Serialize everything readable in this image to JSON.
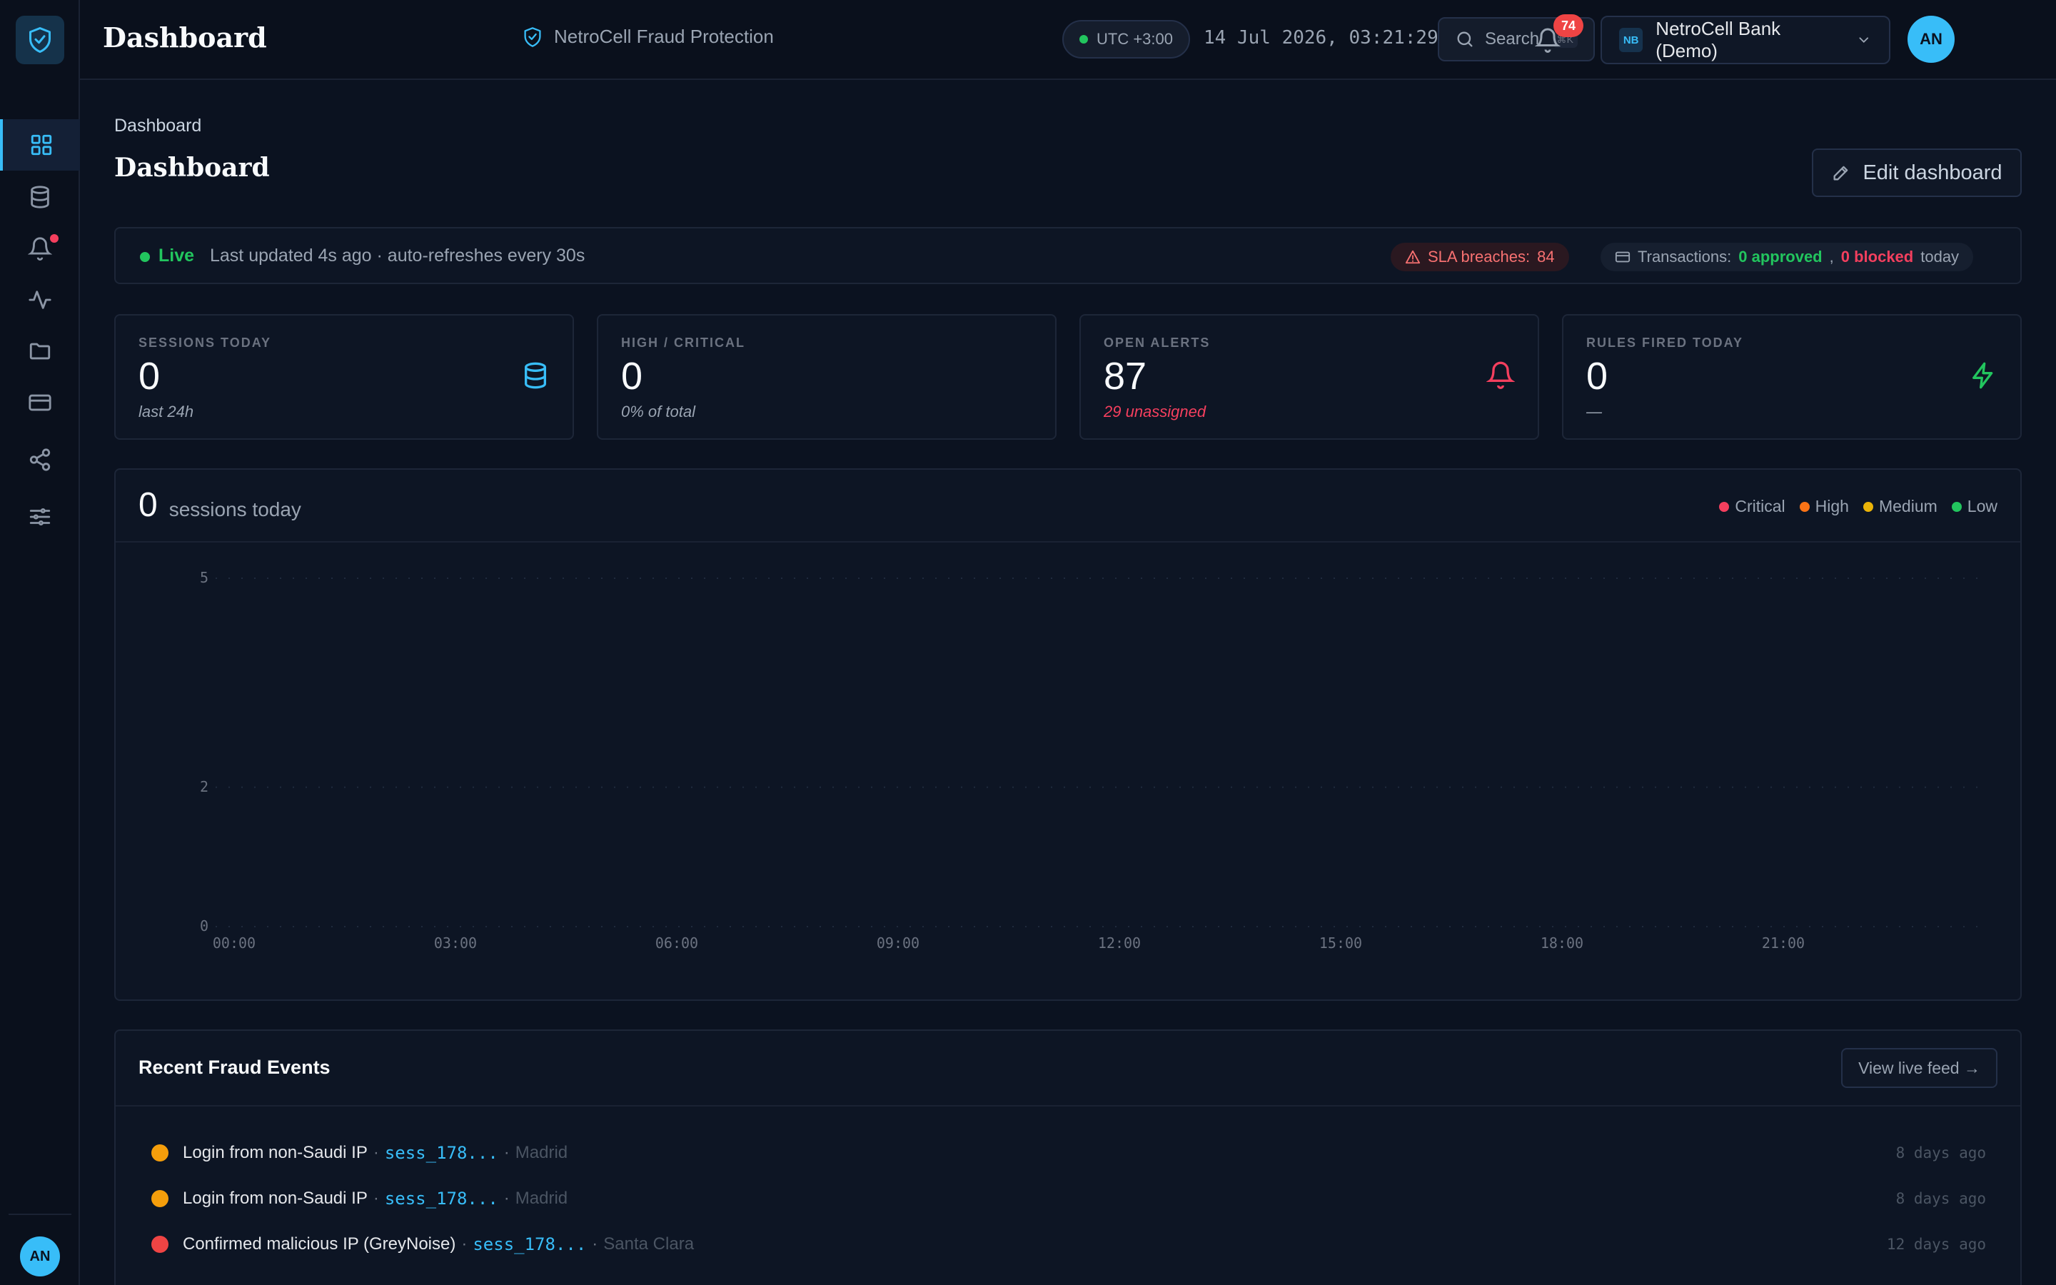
{
  "header": {
    "title": "Dashboard",
    "product": "NetroCell Fraud Protection",
    "timezone": "UTC +3:00",
    "datetime": "14 Jul 2026, 03:21:29",
    "search_label": "Search",
    "search_shortcut": "⌘K",
    "notification_count": "74",
    "org_initials": "NB",
    "org_name": "NetroCell Bank (Demo)",
    "user_initials": "AN"
  },
  "sidebar": {
    "items": [
      "dashboard",
      "sessions",
      "alerts",
      "activity",
      "cases",
      "transactions",
      "network",
      "rules"
    ],
    "user_initials": "AN"
  },
  "page": {
    "breadcrumb": "Dashboard",
    "title": "Dashboard",
    "edit_label": "Edit dashboard"
  },
  "status": {
    "live_label": "Live",
    "updated_text": "Last updated 4s ago · auto-refreshes every 30s",
    "sla_label": "SLA breaches:",
    "sla_value": "84",
    "tx_label": "Transactions:",
    "tx_approved": "0 approved",
    "tx_comma": ",",
    "tx_blocked": "0 blocked",
    "tx_suffix": "today"
  },
  "cards": [
    {
      "label": "SESSIONS TODAY",
      "value": "0",
      "sub": "last 24h"
    },
    {
      "label": "HIGH / CRITICAL",
      "value": "0",
      "sub": "0% of total"
    },
    {
      "label": "OPEN ALERTS",
      "value": "87",
      "sub": "29 unassigned"
    },
    {
      "label": "RULES FIRED TODAY",
      "value": "0",
      "sub": "—"
    }
  ],
  "chart": {
    "count": "0",
    "caption": "sessions today",
    "legend": [
      {
        "name": "Critical",
        "color": "#f43f5e"
      },
      {
        "name": "High",
        "color": "#f97316"
      },
      {
        "name": "Medium",
        "color": "#eab308"
      },
      {
        "name": "Low",
        "color": "#22c55e"
      }
    ]
  },
  "chart_data": {
    "type": "area",
    "title": "",
    "x": [
      "00:00",
      "03:00",
      "06:00",
      "09:00",
      "12:00",
      "15:00",
      "18:00",
      "21:00"
    ],
    "y_ticks": [
      "5",
      "2",
      "0"
    ],
    "ylim": [
      0,
      5
    ],
    "series": [
      {
        "name": "Critical",
        "values": [
          0,
          0,
          0,
          0,
          0,
          0,
          0,
          0
        ]
      },
      {
        "name": "High",
        "values": [
          0,
          0,
          0,
          0,
          0,
          0,
          0,
          0
        ]
      },
      {
        "name": "Medium",
        "values": [
          0,
          0,
          0,
          0,
          0,
          0,
          0,
          0
        ]
      },
      {
        "name": "Low",
        "values": [
          0,
          0,
          0,
          0,
          0,
          0,
          0,
          0
        ]
      }
    ],
    "grid": true,
    "legend": "top-right"
  },
  "events": {
    "title": "Recent Fraud Events",
    "feed_label": "View live feed →",
    "items": [
      {
        "severity_color": "#f59e0b",
        "title": "Login from non-Saudi IP",
        "session": "sess_178...",
        "city": "Madrid",
        "time": "8 days ago"
      },
      {
        "severity_color": "#f59e0b",
        "title": "Login from non-Saudi IP",
        "session": "sess_178...",
        "city": "Madrid",
        "time": "8 days ago"
      },
      {
        "severity_color": "#ef4444",
        "title": "Confirmed malicious IP (GreyNoise)",
        "session": "sess_178...",
        "city": "Santa Clara",
        "time": "12 days ago"
      }
    ]
  }
}
